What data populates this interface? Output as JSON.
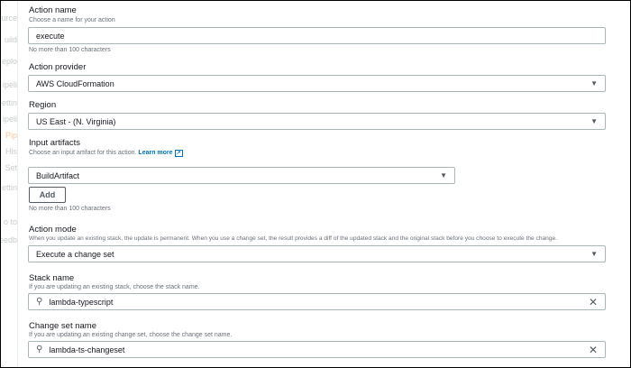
{
  "sidebar": [
    "ource",
    "uild",
    "eplo",
    "ipeli",
    "ettin",
    "ipeli",
    "Pip",
    "His",
    "Set",
    "ettin",
    "o to",
    "eedb"
  ],
  "action_name": {
    "label": "Action name",
    "hint": "Choose a name for your action",
    "value": "execute",
    "constraint": "No more than 100 characters"
  },
  "action_provider": {
    "label": "Action provider",
    "value": "AWS CloudFormation"
  },
  "region": {
    "label": "Region",
    "value": "US East - (N. Virginia)"
  },
  "input_artifacts": {
    "label": "Input artifacts",
    "hint": "Choose an input artifact for this action.",
    "learn_more": "Learn more",
    "value": "BuildArtifact",
    "add_label": "Add",
    "constraint": "No more than 100 characters"
  },
  "action_mode": {
    "label": "Action mode",
    "hint": "When you update an existing stack, the update is permanent. When you use a change set, the result provides a diff of the updated stack and the original stack before you choose to execute the change.",
    "value": "Execute a change set"
  },
  "stack_name": {
    "label": "Stack name",
    "hint": "If you are updating an existing stack, choose the stack name.",
    "value": "lambda-typescript"
  },
  "change_set_name": {
    "label": "Change set name",
    "hint": "If you are updating an existing change set, choose the change set name.",
    "value": "lambda-ts-changeset"
  },
  "icons": {
    "caret": "▼",
    "search": "⚲",
    "clear": "✕",
    "external": "↗"
  }
}
